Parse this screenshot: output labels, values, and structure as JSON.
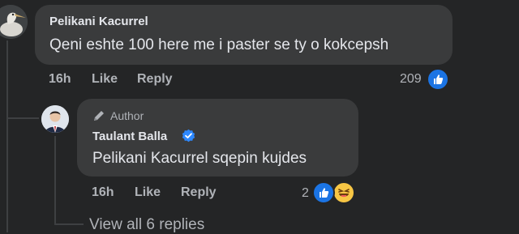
{
  "comment": {
    "author": "Pelikani Kacurrel",
    "text": "Qeni eshte 100 here me i paster se ty o kokcepsh",
    "time": "16h",
    "like_label": "Like",
    "reply_label": "Reply",
    "reaction_count": "209",
    "reaction_icon": "like-icon"
  },
  "reply": {
    "author_tag": "Author",
    "author": "Taulant Balla",
    "verified_icon": "verified-badge-icon",
    "text": "Pelikani Kacurrel sqepin kujdes",
    "time": "16h",
    "like_label": "Like",
    "reply_label": "Reply",
    "reaction_count": "2",
    "reaction_icons": [
      "like-icon",
      "haha-icon"
    ]
  },
  "view_replies_label": "View all 6 replies",
  "colors": {
    "background": "#242526",
    "bubble": "#3a3b3c",
    "text_primary": "#e4e6eb",
    "text_secondary": "#b0b3b8",
    "accent_blue": "#1b74e4",
    "haha_yellow": "#f7c644"
  }
}
